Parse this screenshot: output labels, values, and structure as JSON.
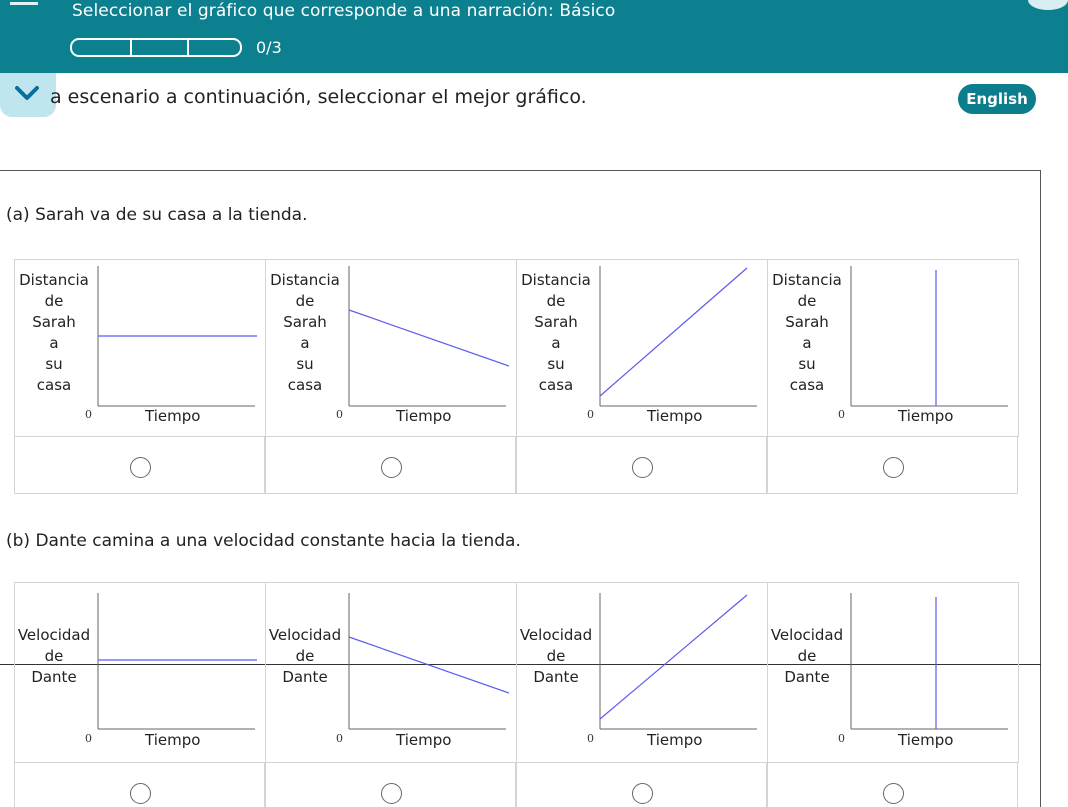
{
  "header": {
    "title": "Seleccionar el gráfico que corresponde a una narración: Básico",
    "progress_label": "0/3",
    "progress_completed": 0,
    "progress_total": 3
  },
  "instruction": "a escenario a continuación, seleccionar el mejor gráfico.",
  "language_button": "English",
  "colors": {
    "header": "#0d8090",
    "accent": "#0b7d8c",
    "plot_line": "#5b5bf0"
  },
  "icons": {
    "menu": "hamburger-icon",
    "collapse": "chevron-down-icon"
  },
  "questions": [
    {
      "prompt": "(a) Sarah va de su casa a la tienda.",
      "y_label_lines": [
        "Distancia",
        "de",
        "Sarah",
        "a",
        "su",
        "casa"
      ],
      "x_label": "Tiempo",
      "origin_label": "0",
      "options": [
        {
          "shape": "horizontal",
          "selected": false
        },
        {
          "shape": "decreasing",
          "selected": false
        },
        {
          "shape": "increasing",
          "selected": false
        },
        {
          "shape": "vertical",
          "selected": false
        }
      ]
    },
    {
      "prompt": "(b) Dante camina a una velocidad constante hacia la tienda.",
      "y_label_lines": [
        "Velocidad",
        "de",
        "Dante"
      ],
      "x_label": "Tiempo",
      "origin_label": "0",
      "options": [
        {
          "shape": "horizontal",
          "selected": false
        },
        {
          "shape": "decreasing",
          "selected": false
        },
        {
          "shape": "increasing",
          "selected": false
        },
        {
          "shape": "vertical",
          "selected": false
        }
      ]
    }
  ]
}
